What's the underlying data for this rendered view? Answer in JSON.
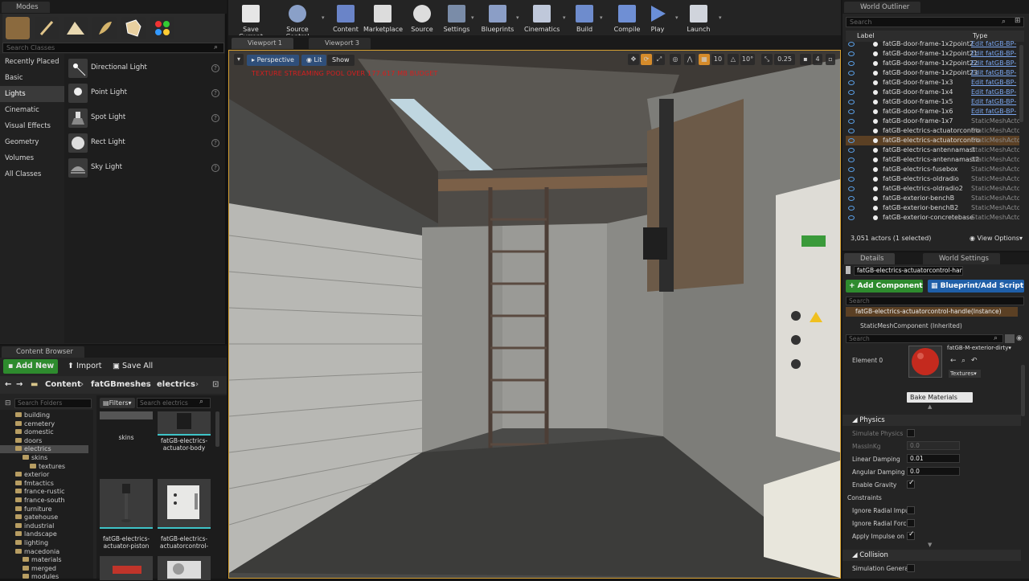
{
  "modes": {
    "tab_label": "Modes",
    "search_placeholder": "Search Classes",
    "categories": [
      "Recently Placed",
      "Basic",
      "Lights",
      "Cinematic",
      "Visual Effects",
      "Geometry",
      "Volumes",
      "All Classes"
    ],
    "selected_category": "Lights",
    "items": [
      "Directional Light",
      "Point Light",
      "Spot Light",
      "Rect Light",
      "Sky Light"
    ]
  },
  "toolbar": {
    "buttons": [
      "Save Current",
      "Source Control",
      "Content",
      "Marketplace",
      "Source",
      "Settings",
      "Blueprints",
      "Cinematics",
      "Build",
      "Compile",
      "Play",
      "Launch"
    ]
  },
  "viewport": {
    "tabs": [
      "Viewport 1",
      "Viewport 3"
    ],
    "perspective_label": "Perspective",
    "lit_label": "Lit",
    "show_label": "Show",
    "warning": "TEXTURE STREAMING POOL OVER 177.617 MB BUDGET",
    "grid_value": "10",
    "rotation_value": "10°",
    "scale_value": "0.25",
    "camera_speed": "4"
  },
  "content_browser": {
    "tab_label": "Content Browser",
    "add_new": "Add New",
    "import": "Import",
    "save_all": "Save All",
    "breadcrumb": [
      "Content",
      "fatGBmeshes",
      "electrics"
    ],
    "folder_search_placeholder": "Search Folders",
    "filters_label": "Filters",
    "asset_search_placeholder": "Search electrics",
    "tree": [
      {
        "label": "building",
        "depth": 1
      },
      {
        "label": "cemetery",
        "depth": 1
      },
      {
        "label": "domestic",
        "depth": 1
      },
      {
        "label": "doors",
        "depth": 1
      },
      {
        "label": "electrics",
        "depth": 1,
        "selected": true
      },
      {
        "label": "skins",
        "depth": 2
      },
      {
        "label": "textures",
        "depth": 3
      },
      {
        "label": "exterior",
        "depth": 1
      },
      {
        "label": "fmtactics",
        "depth": 1
      },
      {
        "label": "france-rustic",
        "depth": 1
      },
      {
        "label": "france-south",
        "depth": 1
      },
      {
        "label": "furniture",
        "depth": 1
      },
      {
        "label": "gatehouse",
        "depth": 1
      },
      {
        "label": "industrial",
        "depth": 1
      },
      {
        "label": "landscape",
        "depth": 1
      },
      {
        "label": "lighting",
        "depth": 1
      },
      {
        "label": "macedonia",
        "depth": 1
      },
      {
        "label": "materials",
        "depth": 2
      },
      {
        "label": "merged",
        "depth": 2
      },
      {
        "label": "modules",
        "depth": 2
      }
    ],
    "assets": [
      "skins",
      "fatGB-electrics-actuator-body",
      "fatGB-electrics-actuator-piston",
      "fatGB-electrics-actuatorcontrol-box",
      "",
      ""
    ]
  },
  "outliner": {
    "tab_label": "World Outliner",
    "search_placeholder": "Search",
    "col_label": "Label",
    "col_type": "Type",
    "rows": [
      {
        "label": "fatGB-door-frame-1x2point2",
        "type": "Edit fatGB-BP-",
        "link": true
      },
      {
        "label": "fatGB-door-frame-1x2point21",
        "type": "Edit fatGB-BP-",
        "link": true
      },
      {
        "label": "fatGB-door-frame-1x2point22",
        "type": "Edit fatGB-BP-",
        "link": true
      },
      {
        "label": "fatGB-door-frame-1x2point23",
        "type": "Edit fatGB-BP-",
        "link": true
      },
      {
        "label": "fatGB-door-frame-1x3",
        "type": "Edit fatGB-BP-",
        "link": true
      },
      {
        "label": "fatGB-door-frame-1x4",
        "type": "Edit fatGB-BP-",
        "link": true
      },
      {
        "label": "fatGB-door-frame-1x5",
        "type": "Edit fatGB-BP-",
        "link": true
      },
      {
        "label": "fatGB-door-frame-1x6",
        "type": "Edit fatGB-BP-",
        "link": true
      },
      {
        "label": "fatGB-door-frame-1x7",
        "type": "StaticMeshActo",
        "link": false
      },
      {
        "label": "fatGB-electrics-actuatorcontro",
        "type": "StaticMeshActo",
        "link": false
      },
      {
        "label": "fatGB-electrics-actuatorcontro",
        "type": "StaticMeshActo",
        "link": false,
        "selected": true
      },
      {
        "label": "fatGB-electrics-antennamast",
        "type": "StaticMeshActo",
        "link": false
      },
      {
        "label": "fatGB-electrics-antennamast2",
        "type": "StaticMeshActo",
        "link": false
      },
      {
        "label": "fatGB-electrics-fusebox",
        "type": "StaticMeshActo",
        "link": false
      },
      {
        "label": "fatGB-electrics-oldradio",
        "type": "StaticMeshActo",
        "link": false
      },
      {
        "label": "fatGB-electrics-oldradio2",
        "type": "StaticMeshActo",
        "link": false
      },
      {
        "label": "fatGB-exterior-benchB",
        "type": "StaticMeshActo",
        "link": false
      },
      {
        "label": "fatGB-exterior-benchB2",
        "type": "StaticMeshActo",
        "link": false
      },
      {
        "label": "fatGB-exterior-concretebase",
        "type": "StaticMeshActo",
        "link": false
      }
    ],
    "status": "3,051 actors (1 selected)",
    "view_options": "View Options"
  },
  "details": {
    "tab_label": "Details",
    "tab2_label": "World Settings",
    "name_value": "fatGB-electrics-actuatorcontrol-han",
    "add_component": "+ Add Component",
    "blueprint_script": "Blueprint/Add Script",
    "search_placeholder": "Search",
    "instance_label": "fatGB-electrics-actuatorcontrol-handle(Instance)",
    "component_label": "StaticMeshComponent (Inherited)",
    "search2_placeholder": "Search",
    "element_label": "Element 0",
    "material_name": "fatGB-M-exterior-dirty",
    "textures_label": "Textures",
    "bake_materials": "Bake Materials",
    "physics_section": "Physics",
    "collision_section": "Collision",
    "props": [
      {
        "name": "Simulate Physics",
        "kind": "check",
        "on": false,
        "dim": true
      },
      {
        "name": "MassInKg",
        "kind": "num",
        "value": "0.0",
        "dim": true
      },
      {
        "name": "Linear Damping",
        "kind": "num",
        "value": "0.01",
        "dim": false
      },
      {
        "name": "Angular Damping",
        "kind": "num",
        "value": "0.0",
        "dim": false
      },
      {
        "name": "Enable Gravity",
        "kind": "check",
        "on": true,
        "dim": false
      },
      {
        "name": "Constraints",
        "kind": "none",
        "dim": false
      },
      {
        "name": "Ignore Radial Impul",
        "kind": "check",
        "on": false,
        "dim": false
      },
      {
        "name": "Ignore Radial Force",
        "kind": "check",
        "on": false,
        "dim": false
      },
      {
        "name": "Apply Impulse on D",
        "kind": "check",
        "on": true,
        "dim": false
      }
    ],
    "collision_prop": "Simulation Generat"
  }
}
